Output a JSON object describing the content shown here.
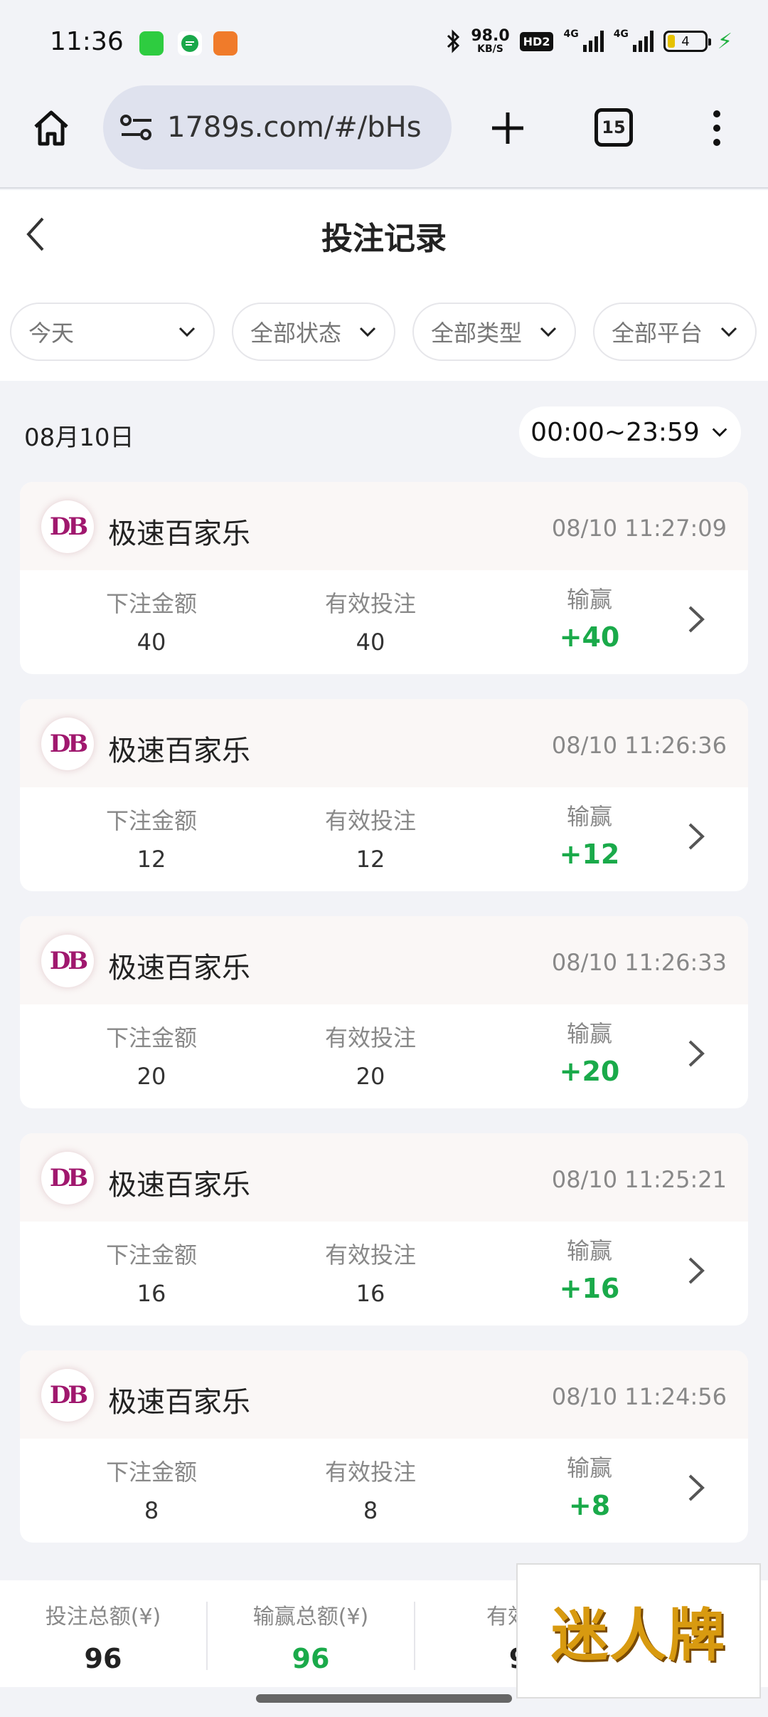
{
  "status_bar": {
    "time": "11:36",
    "speed_value": "98.0",
    "speed_unit": "KB/S",
    "hd_label": "HD2",
    "net1": "4G",
    "net2": "4G",
    "battery": "4",
    "app_icon_colors": [
      "#2ecc40",
      "#1aa84a",
      "#f07b2a"
    ]
  },
  "browser": {
    "url": "1789s.com/#/bHs",
    "tab_count": "15"
  },
  "header": {
    "title": "投注记录"
  },
  "filters": [
    {
      "label": "今天"
    },
    {
      "label": "全部状态"
    },
    {
      "label": "全部类型"
    },
    {
      "label": "全部平台"
    }
  ],
  "date_row": {
    "date": "08月10日",
    "time_range": "00:00~23:59"
  },
  "labels": {
    "bet_amount": "下注金额",
    "valid_bet": "有效投注",
    "win_loss": "输赢"
  },
  "records": [
    {
      "logo": "DB",
      "game": "极速百家乐",
      "time": "08/10 11:27:09",
      "bet": "40",
      "valid": "40",
      "win": "+40"
    },
    {
      "logo": "DB",
      "game": "极速百家乐",
      "time": "08/10 11:26:36",
      "bet": "12",
      "valid": "12",
      "win": "+12"
    },
    {
      "logo": "DB",
      "game": "极速百家乐",
      "time": "08/10 11:26:33",
      "bet": "20",
      "valid": "20",
      "win": "+20"
    },
    {
      "logo": "DB",
      "game": "极速百家乐",
      "time": "08/10 11:25:21",
      "bet": "16",
      "valid": "16",
      "win": "+16"
    },
    {
      "logo": "DB",
      "game": "极速百家乐",
      "time": "08/10 11:24:56",
      "bet": "8",
      "valid": "8",
      "win": "+8"
    }
  ],
  "footer": {
    "total_bet_label": "投注总额(¥)",
    "total_bet": "96",
    "total_win_label": "输赢总额(¥)",
    "total_win": "96",
    "valid_label": "有效投",
    "valid_value": "9"
  },
  "watermark": "迷人牌",
  "colors": {
    "win_green": "#1aaa4a",
    "logo_magenta": "#a0186e"
  }
}
